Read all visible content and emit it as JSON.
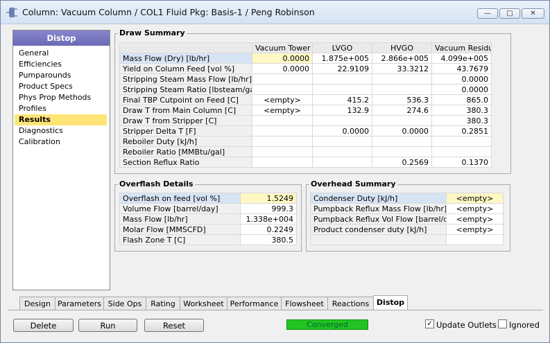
{
  "window": {
    "title": "Column: Vacuum Column / COL1  Fluid Pkg: Basis-1 / Peng Robinson",
    "icon": "column-icon",
    "minimize": "—",
    "maximize": "□",
    "close": "✕"
  },
  "sidebar": {
    "title": "Distop",
    "items": [
      {
        "label": "General"
      },
      {
        "label": "Efficiencies"
      },
      {
        "label": "Pumparounds"
      },
      {
        "label": "Product Specs"
      },
      {
        "label": "Phys Prop Methods"
      },
      {
        "label": "Profiles"
      },
      {
        "label": "Results"
      },
      {
        "label": "Diagnostics"
      },
      {
        "label": "Calibration"
      }
    ],
    "selected": "Results"
  },
  "draw_summary": {
    "title": "Draw Summary",
    "columns": [
      "Vacuum Tower Ovhd",
      "LVGO",
      "HVGO",
      "Vacuum Residue"
    ],
    "rows": [
      {
        "label": "Mass Flow (Dry) [lb/hr]",
        "values": [
          "0.0000",
          "1.875e+005",
          "2.866e+005",
          "4.099e+005"
        ]
      },
      {
        "label": "Yield on Column Feed [vol %]",
        "values": [
          "0.0000",
          "22.9109",
          "33.3212",
          "43.7679"
        ]
      },
      {
        "label": "Stripping Steam Mass Flow [lb/hr]",
        "values": [
          "",
          "",
          "",
          "0.0000"
        ]
      },
      {
        "label": "Stripping Steam Ratio [lbsteam/gal]",
        "values": [
          "",
          "",
          "",
          "0.0000"
        ]
      },
      {
        "label": "Final TBP Cutpoint on Feed [C]",
        "values": [
          "<empty>",
          "415.2",
          "536.3",
          "865.0"
        ]
      },
      {
        "label": "Draw T from Main Column [C]",
        "values": [
          "<empty>",
          "132.9",
          "274.6",
          "380.3"
        ]
      },
      {
        "label": "Draw T from Stripper [C]",
        "values": [
          "",
          "",
          "",
          "380.3"
        ]
      },
      {
        "label": "Stripper Delta T [F]",
        "values": [
          "",
          "0.0000",
          "0.0000",
          "0.2851"
        ]
      },
      {
        "label": "Reboiler Duty [kJ/h]",
        "values": [
          "",
          "",
          "",
          ""
        ]
      },
      {
        "label": "Reboiler Ratio [MMBtu/gal]",
        "values": [
          "",
          "",
          "",
          ""
        ]
      },
      {
        "label": "Section Reflux Ratio",
        "values": [
          "",
          "",
          "0.2569",
          "0.1370"
        ]
      }
    ]
  },
  "overflash": {
    "title": "Overflash Details",
    "rows": [
      {
        "label": "Overflash on feed [vol %]",
        "value": "1.5249"
      },
      {
        "label": "Volume Flow [barrel/day]",
        "value": "999.3"
      },
      {
        "label": "Mass Flow [lb/hr]",
        "value": "1.338e+004"
      },
      {
        "label": "Molar Flow [MMSCFD]",
        "value": "0.2249"
      },
      {
        "label": "Flash Zone T [C]",
        "value": "380.5"
      }
    ]
  },
  "overhead": {
    "title": "Overhead Summary",
    "rows": [
      {
        "label": "Condenser Duty [kJ/h]",
        "value": "<empty>"
      },
      {
        "label": "Pumpback Reflux Mass Flow [lb/hr]",
        "value": "<empty>"
      },
      {
        "label": "Pumpback Reflux Vol Flow [barrel/day]",
        "value": "<empty>"
      },
      {
        "label": "Product condenser duty [kJ/h]",
        "value": "<empty>"
      },
      {
        "label": "",
        "value": ""
      }
    ]
  },
  "tabs": [
    {
      "label": "Design"
    },
    {
      "label": "Parameters"
    },
    {
      "label": "Side Ops"
    },
    {
      "label": "Rating"
    },
    {
      "label": "Worksheet"
    },
    {
      "label": "Performance"
    },
    {
      "label": "Flowsheet"
    },
    {
      "label": "Reactions"
    },
    {
      "label": "Distop"
    }
  ],
  "active_tab": "Distop",
  "buttons": {
    "delete": "Delete",
    "run": "Run",
    "reset": "Reset"
  },
  "status": {
    "text": "Converged",
    "color": "#22c322"
  },
  "checkboxes": {
    "update_outlets": {
      "label": "Update Outlets",
      "checked": true,
      "mark": "✓"
    },
    "ignored": {
      "label": "Ignored",
      "checked": false
    }
  }
}
